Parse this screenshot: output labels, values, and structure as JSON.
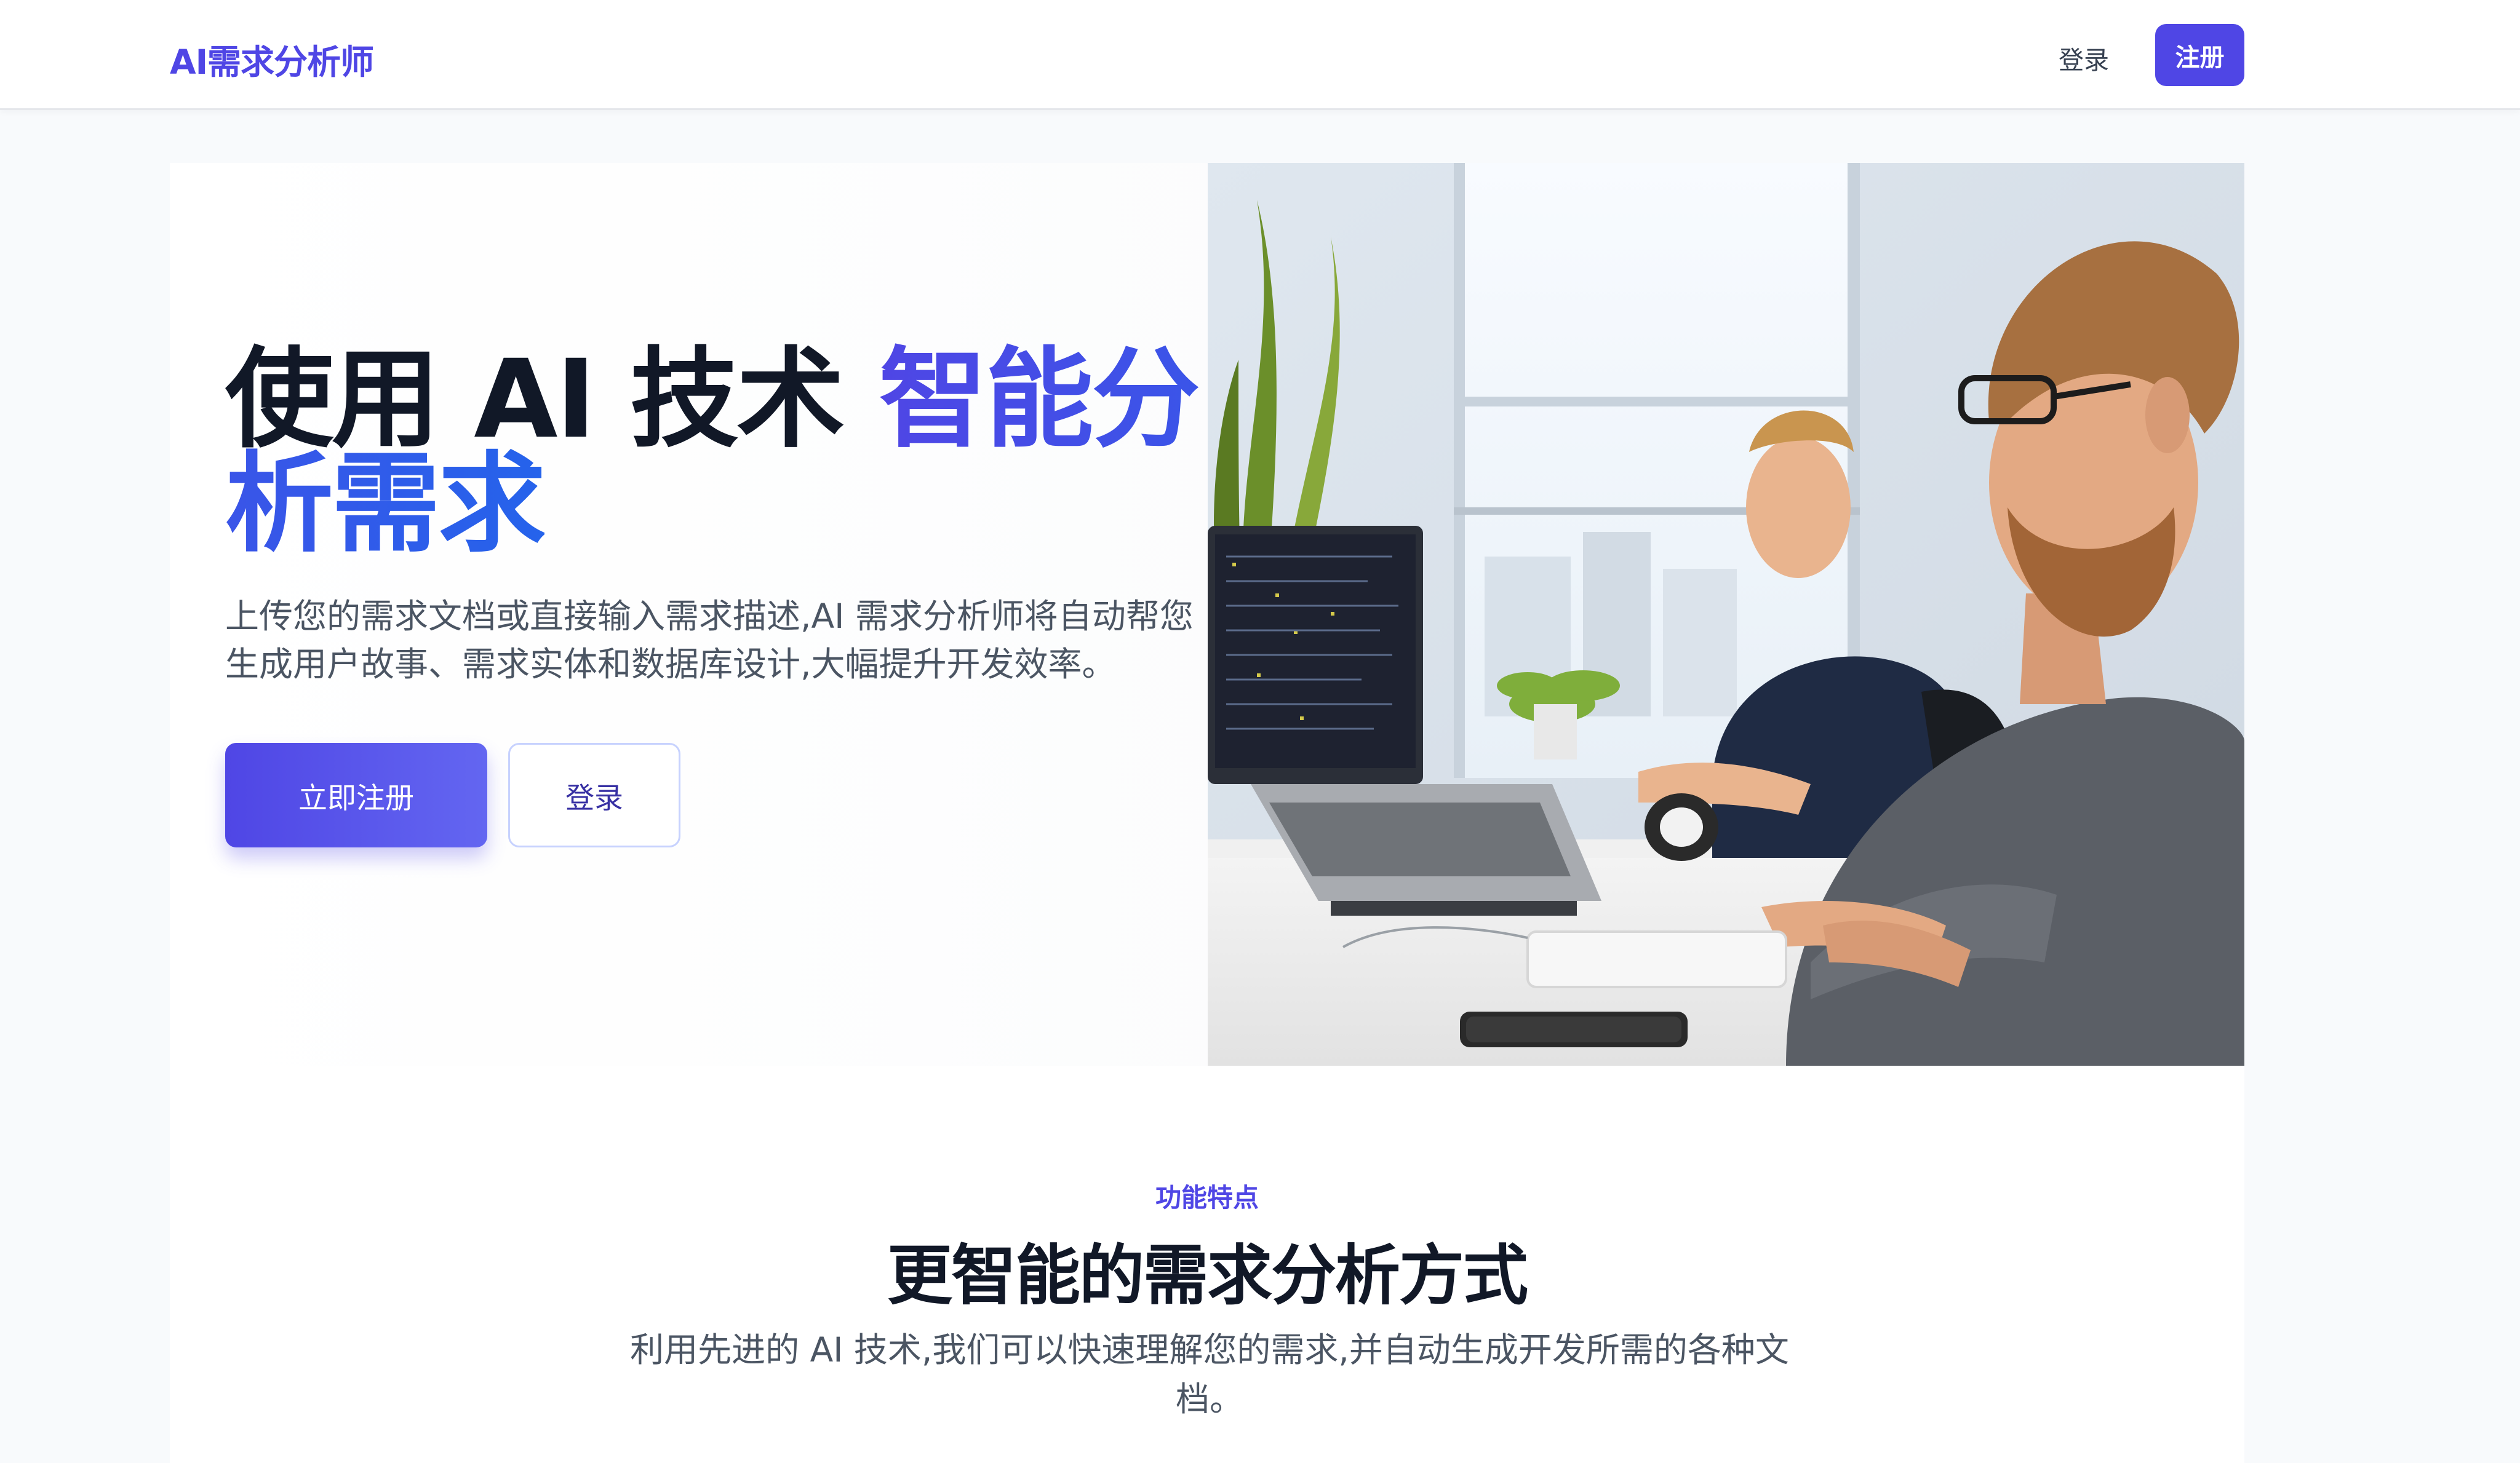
{
  "header": {
    "brand": "AI需求分析师",
    "login_label": "登录",
    "register_label": "注册"
  },
  "hero": {
    "title_plain": "使用 AI 技术 ",
    "title_accent": "智能分析需求",
    "description": "上传您的需求文档或直接输入需求描述,AI 需求分析师将自动帮您生成用户故事、需求实体和数据库设计,大幅提升开发效率。",
    "primary_cta": "立即注册",
    "secondary_cta": "登录"
  },
  "features": {
    "eyebrow": "功能特点",
    "title": "更智能的需求分析方式",
    "description": "利用先进的 AI 技术,我们可以快速理解您的需求,并自动生成开发所需的各种文档。"
  },
  "colors": {
    "accent": "#4f46e5",
    "accent_blue": "#2563eb",
    "text_dark": "#111827",
    "text_muted": "#4b5563"
  }
}
